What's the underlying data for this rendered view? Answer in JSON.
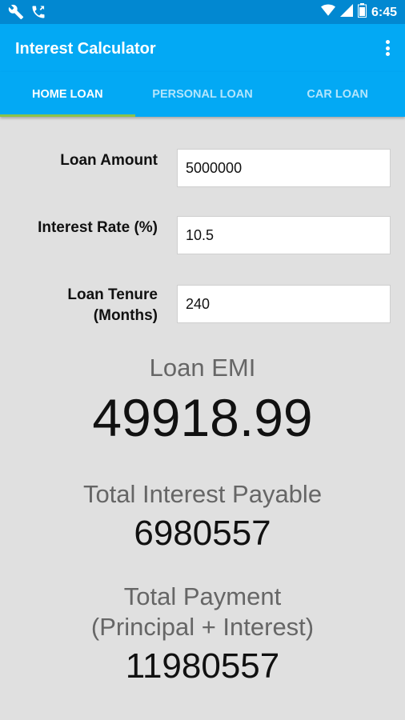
{
  "status_bar": {
    "time": "6:45",
    "left_icons": [
      "wrench-icon",
      "missed-call-icon"
    ],
    "right_icons": [
      "wifi-icon",
      "signal-icon",
      "battery-icon"
    ]
  },
  "app_bar": {
    "title": "Interest Calculator",
    "menu_icon": "more-vert-icon"
  },
  "tabs": [
    {
      "label": "HOME LOAN",
      "active": true
    },
    {
      "label": "PERSONAL LOAN",
      "active": false
    },
    {
      "label": "CAR LOAN",
      "active": false
    }
  ],
  "form": {
    "loan_amount": {
      "label": "Loan Amount",
      "value": "5000000"
    },
    "interest_rate": {
      "label": "Interest Rate (%)",
      "value": "10.5"
    },
    "loan_tenure": {
      "label_line1": "Loan Tenure",
      "label_line2": "(Months)",
      "value": "240"
    }
  },
  "results": {
    "emi_label": "Loan EMI",
    "emi_value": "49918.99",
    "interest_label": "Total Interest Payable",
    "interest_value": "6980557",
    "payment_label_line1": "Total Payment",
    "payment_label_line2": "(Principal + Interest)",
    "payment_value": "11980557"
  },
  "colors": {
    "status_bar": "#0288d1",
    "app_bar": "#03a9f4",
    "tab_indicator": "#8bc34a",
    "background": "#e0e0e0"
  }
}
